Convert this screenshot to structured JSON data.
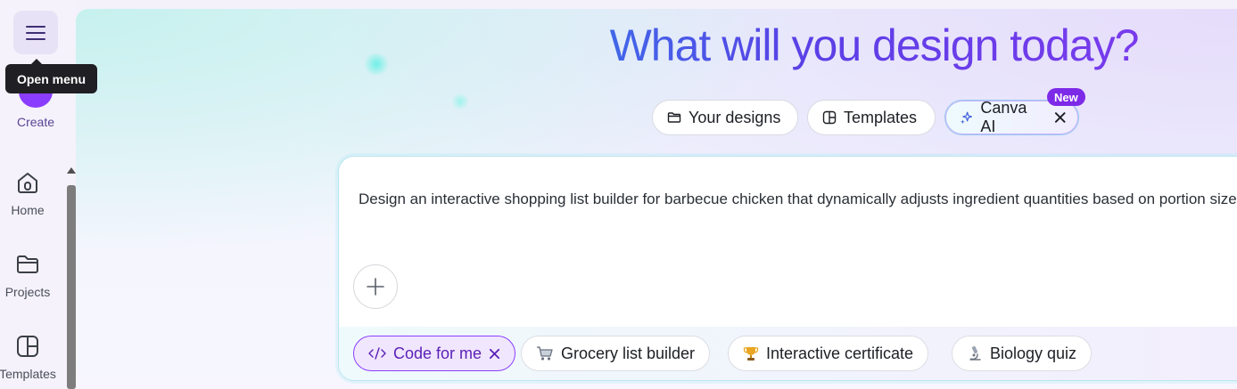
{
  "sidebar": {
    "menu_icon": "hamburger-icon",
    "tooltip": "Open menu",
    "create_label": "Create",
    "items": [
      {
        "label": "Home",
        "icon": "home-icon"
      },
      {
        "label": "Projects",
        "icon": "folder-icon"
      },
      {
        "label": "Templates",
        "icon": "templates-icon"
      }
    ]
  },
  "hero": {
    "title": "What will you design today?",
    "tabs": [
      {
        "label": "Your designs",
        "icon": "folder-icon"
      },
      {
        "label": "Templates",
        "icon": "templates-icon"
      },
      {
        "label": "Canva AI",
        "icon": "sparkle-icon",
        "badge": "New"
      }
    ]
  },
  "prompt": {
    "text": "Design an interactive shopping list builder for barbecue chicken that dynamically adjusts ingredient quantities based on portion size."
  },
  "chips": [
    {
      "label": "Code for me",
      "icon": "code-icon",
      "active": true
    },
    {
      "label": "Grocery list builder",
      "icon": "cart-icon"
    },
    {
      "label": "Interactive certificate",
      "icon": "trophy-icon"
    },
    {
      "label": "Biology quiz",
      "icon": "microscope-icon"
    }
  ],
  "colors": {
    "accent": "#8b3dff",
    "title_gradient_start": "#3c6ee8",
    "title_gradient_end": "#7c3aed"
  }
}
